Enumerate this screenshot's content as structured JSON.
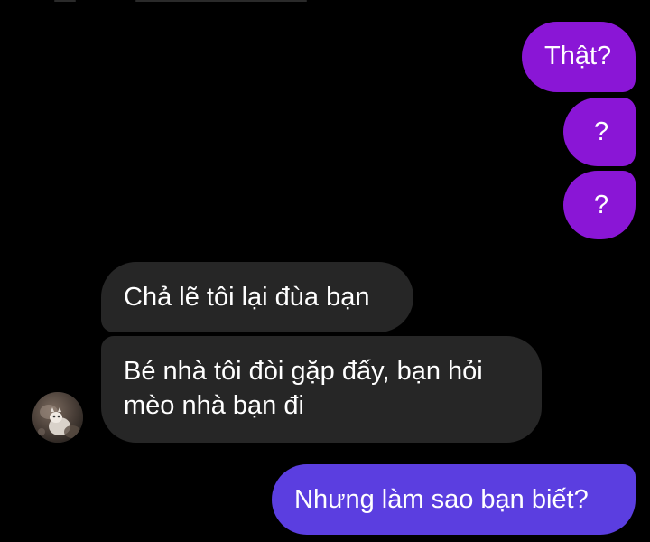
{
  "conversation": {
    "messages": [
      {
        "from": "me",
        "text": "Thật?"
      },
      {
        "from": "me",
        "text": "?"
      },
      {
        "from": "me",
        "text": "?"
      },
      {
        "from": "them",
        "text": "Chả lẽ tôi lại đùa bạn"
      },
      {
        "from": "them",
        "text": "Bé nhà tôi đòi gặp đấy, bạn hỏi mèo nhà bạn đi"
      },
      {
        "from": "me",
        "text": "Nhưng làm sao bạn biết?"
      }
    ]
  },
  "contact": {
    "avatar_icon": "cat-photo-avatar"
  },
  "colors": {
    "background": "#000000",
    "sent_bubble_purple": "#8a16d6",
    "sent_bubble_blue": "#5b3ee0",
    "received_bubble": "#262626",
    "text": "#ffffff"
  }
}
